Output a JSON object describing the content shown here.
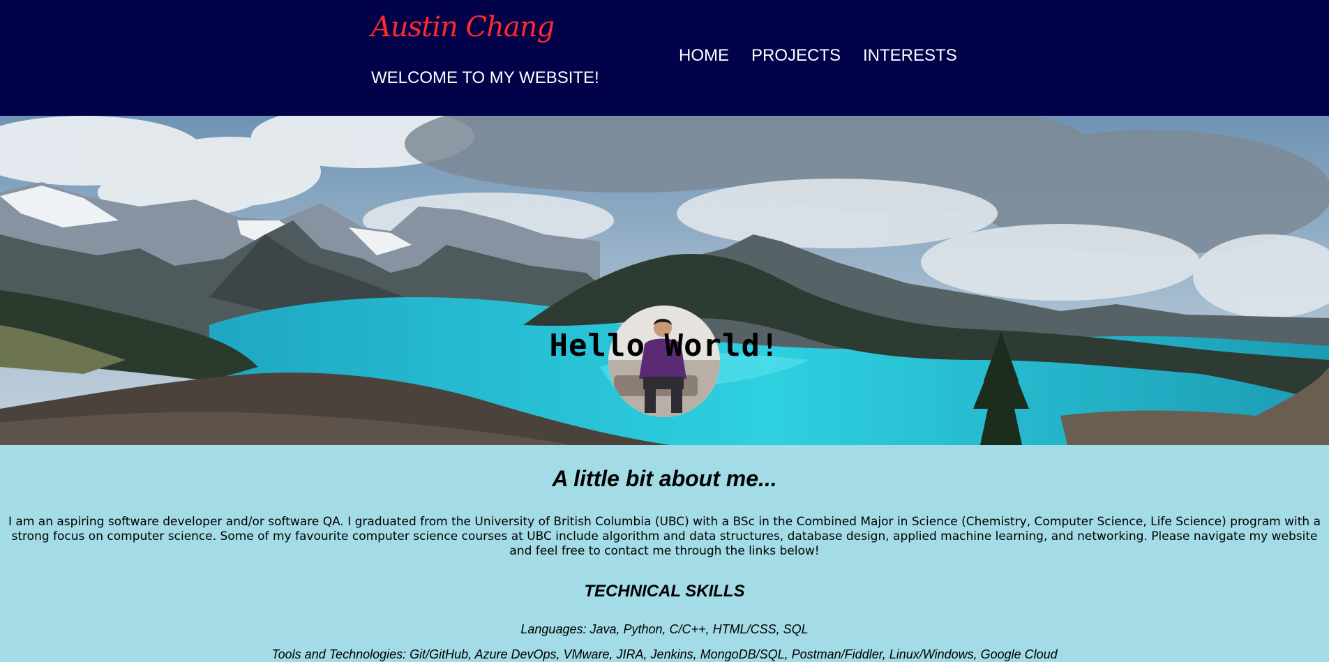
{
  "header": {
    "brand": "Austin Chang",
    "tagline": "WELCOME TO MY WEBSITE!",
    "nav": [
      "HOME",
      "PROJECTS",
      "INTERESTS"
    ]
  },
  "hero": {
    "title": "Hello World!"
  },
  "about": {
    "heading": "A little bit about me...",
    "text": "I am an aspiring software developer and/or software QA. I graduated from the University of British Columbia (UBC) with a BSc in the Combined Major in Science (Chemistry, Computer Science, Life Science) program with a strong focus on computer science. Some of my favourite computer science courses at UBC include algorithm and data structures, database design, applied machine learning, and networking. Please navigate my website and feel free to contact me through the links below!",
    "skills_heading": "TECHNICAL SKILLS",
    "languages": "Languages: Java, Python, C/C++, HTML/CSS, SQL",
    "tools": "Tools and Technologies: Git/GitHub, Azure DevOps, VMware, JIRA, Jenkins, MongoDB/SQL, Postman/Fiddler, Linux/Windows, Google Cloud"
  },
  "colors": {
    "header_bg": "#02024a",
    "brand": "#ff2a2a",
    "about_bg": "#a3dbe6"
  }
}
